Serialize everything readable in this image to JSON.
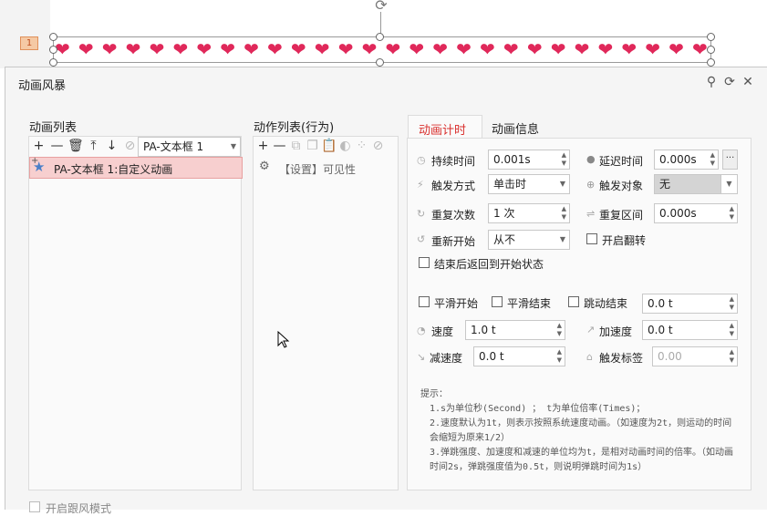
{
  "slide": {
    "number": "1",
    "heart_glyph": "❤",
    "heart_count": 28
  },
  "dialog": {
    "title": "动画风暴",
    "pin_icon": "pin-icon",
    "refresh_icon": "refresh-icon",
    "close_icon": "close-icon"
  },
  "anim_list": {
    "title": "动画列表",
    "object_select": "PA-文本框 1",
    "items": [
      {
        "label": "PA-文本框 1:自定义动画"
      }
    ]
  },
  "action_list": {
    "title": "动作列表(行为)",
    "items": [
      {
        "label": "【设置】可见性"
      }
    ]
  },
  "tabs": [
    {
      "label": "动画计时",
      "active": true
    },
    {
      "label": "动画信息",
      "active": false
    }
  ],
  "timing": {
    "duration_label": "持续时间",
    "duration_value": "0.001s",
    "delay_label": "延迟时间",
    "delay_value": "0.000s",
    "delay_more": "···",
    "trigger_label": "触发方式",
    "trigger_value": "单击时",
    "trigger_target_label": "触发对象",
    "trigger_target_value": "无",
    "repeat_label": "重复次数",
    "repeat_value": "1 次",
    "repeat_interval_label": "重复区间",
    "repeat_interval_value": "0.000s",
    "restart_label": "重新开始",
    "restart_value": "从不",
    "flip_label": "开启翻转",
    "return_label": "结束后返回到开始状态",
    "smooth_start_label": "平滑开始",
    "smooth_end_label": "平滑结束",
    "bounce_end_label": "跳动结束",
    "bounce_value": "0.0 t",
    "speed_label": "速度",
    "speed_value": "1.0 t",
    "accel_label": "加速度",
    "accel_value": "0.0 t",
    "decel_label": "减速度",
    "decel_value": "0.0 t",
    "trigger_tag_label": "触发标签",
    "trigger_tag_value": "0.00"
  },
  "hint": {
    "title": "提示：",
    "line1": "1.s为单位秒(Second) ； t为单位倍率(Times)；",
    "line2": "2.速度默认为1t，则表示按照系统速度动画。（如速度为2t，则运动的时间会缩短为原来1/2）",
    "line3": "3.弹跳强度、加速度和减速的单位均为t，是相对动画时间的倍率。（如动画时间2s，弹跳强度值为0.5t，则说明弹跳时间为1s）"
  },
  "footer": {
    "follow_mode_label": "开启跟风模式"
  },
  "colors": {
    "accent": "#d9302e",
    "heart": "#e0285a",
    "selection": "#f7cfcf"
  }
}
